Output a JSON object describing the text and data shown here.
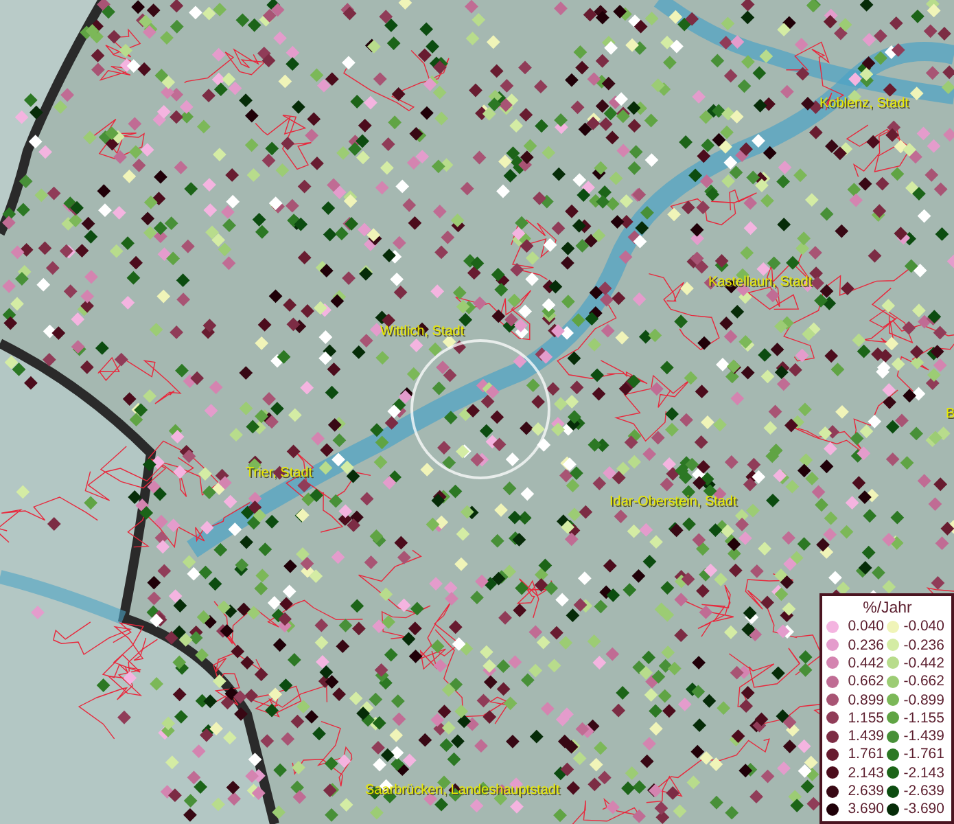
{
  "map": {
    "city_labels": [
      {
        "text": "Koblenz, Stadt"
      },
      {
        "text": "Kastellaun, Stadt"
      },
      {
        "text": "Wittlich, Stadt"
      },
      {
        "text": "Trier, Stadt"
      },
      {
        "text": "Idar-Oberstein, Stadt"
      },
      {
        "text": "Saarbrücken, Landeshauptstadt"
      },
      {
        "text": "B"
      }
    ]
  },
  "legend": {
    "title": "%/Jahr",
    "rows": [
      {
        "left": {
          "label": "0.040",
          "color": "#f4b4e0"
        },
        "right": {
          "label": "-0.040",
          "color": "#f0f4b8"
        }
      },
      {
        "left": {
          "label": "0.236",
          "color": "#e49ccc"
        },
        "right": {
          "label": "-0.236",
          "color": "#d4eca4"
        }
      },
      {
        "left": {
          "label": "0.442",
          "color": "#d484b0"
        },
        "right": {
          "label": "-0.442",
          "color": "#b8dc8c"
        }
      },
      {
        "left": {
          "label": "0.662",
          "color": "#c06c94"
        },
        "right": {
          "label": "-0.662",
          "color": "#9ccc74"
        }
      },
      {
        "left": {
          "label": "0.899",
          "color": "#a85474"
        },
        "right": {
          "label": "-0.899",
          "color": "#7cb858"
        }
      },
      {
        "left": {
          "label": "1.155",
          "color": "#903c58"
        },
        "right": {
          "label": "-1.155",
          "color": "#60a444"
        }
      },
      {
        "left": {
          "label": "1.439",
          "color": "#7c2c44"
        },
        "right": {
          "label": "-1.439",
          "color": "#489038"
        }
      },
      {
        "left": {
          "label": "1.761",
          "color": "#681c30"
        },
        "right": {
          "label": "-1.761",
          "color": "#2c7824"
        }
      },
      {
        "left": {
          "label": "2.143",
          "color": "#4c0c1c"
        },
        "right": {
          "label": "-2.143",
          "color": "#1c6418"
        }
      },
      {
        "left": {
          "label": "2.639",
          "color": "#380814"
        },
        "right": {
          "label": "-2.639",
          "color": "#0c4c10"
        }
      },
      {
        "left": {
          "label": "3.690",
          "color": "#200008"
        },
        "right": {
          "label": "-3.690",
          "color": "#062c08"
        }
      }
    ]
  }
}
